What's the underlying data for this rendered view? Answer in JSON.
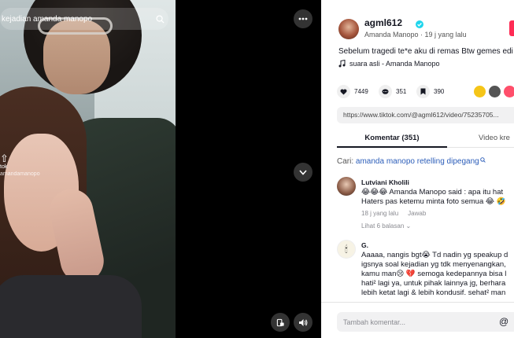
{
  "video": {
    "search_text": "kejadian amanda manopo",
    "side_label": "tok",
    "side_sub": "amandamanopo"
  },
  "author": {
    "username": "agml612",
    "display_name": "Amanda Manopo",
    "time": "19 j yang lalu",
    "accent_color": "#fe2c55",
    "verified_color": "#20d5ec"
  },
  "post": {
    "caption": "Sebelum tragedi te*e aku di remas Btw gemes edi",
    "sound": "suara asli - Amanda Manopo"
  },
  "stats": {
    "likes": "7449",
    "comments": "351",
    "saves": "390"
  },
  "link": {
    "url": "https://www.tiktok.com/@agml612/video/75235705..."
  },
  "tabs": {
    "comments": "Komentar (351)",
    "creator": "Video kre"
  },
  "suggest": {
    "prefix": "Cari: ",
    "query": "amanda manopo retelling dipegang"
  },
  "comments": [
    {
      "name": "Lutviani Kholili",
      "lines": [
        "😂😂😂 Amanda Manopo said : apa itu hat",
        "Haters pas ketemu minta foto semua 😂 🤣"
      ],
      "time": "18 j yang lalu",
      "reply": "Jawab",
      "replies": "Lihat 6 balasan ⌄"
    },
    {
      "name": "G.",
      "avatar_glyph": "🕯",
      "lines": [
        "Aaaaa, nangis bgt😭 Td nadin yg speakup d",
        "igsnya soal kejadian yg tdk menyenangkan,",
        "kamu man😢 💔 semoga kedepannya bisa l",
        "hati² lagi ya, untuk pihak lainnya jg, berhara",
        "lebih ketat lagi & lebih kondusif. sehat² man"
      ]
    }
  ],
  "composer": {
    "placeholder": "Tambah komentar...",
    "mention": "@"
  }
}
